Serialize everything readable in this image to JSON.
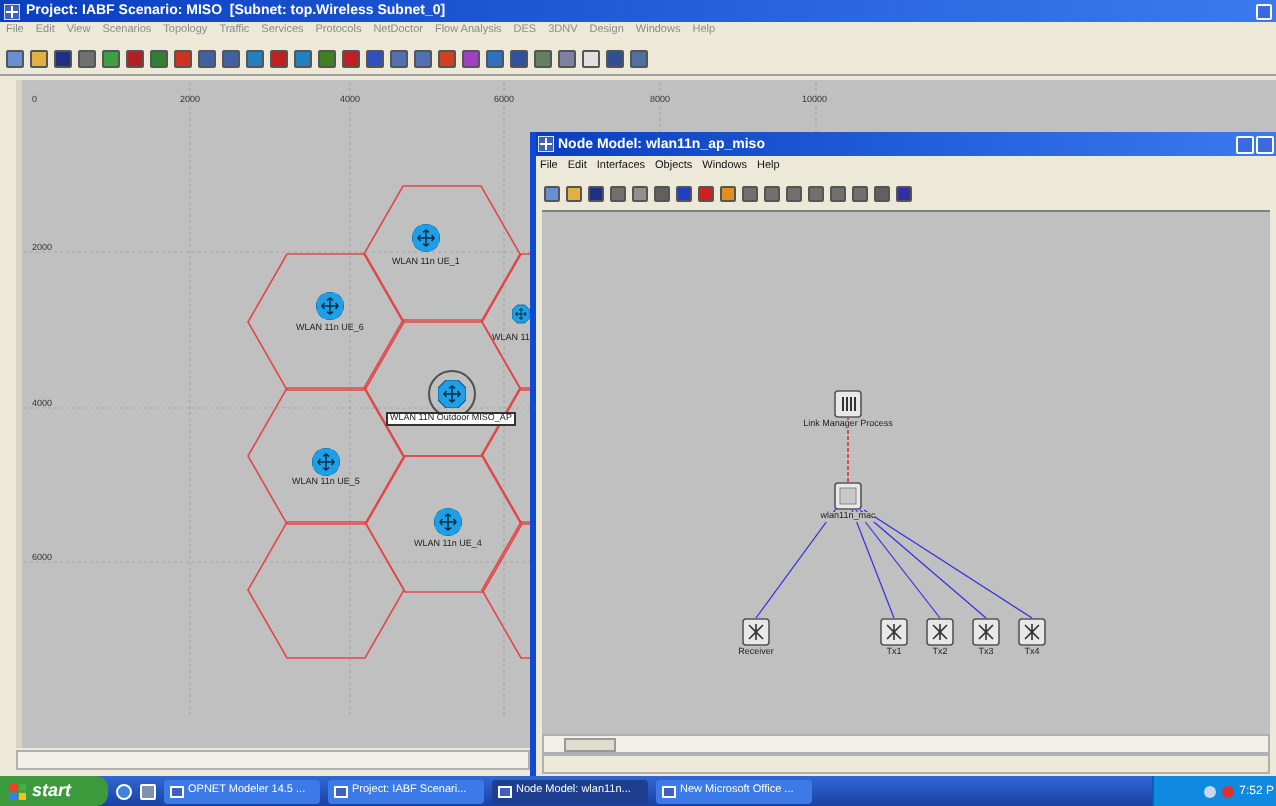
{
  "window": {
    "title": "Project: IABF Scenario: MISO  [Subnet: top.Wireless Subnet_0]"
  },
  "menu": [
    "File",
    "Edit",
    "View",
    "Scenarios",
    "Topology",
    "Traffic",
    "Services",
    "Protocols",
    "NetDoctor",
    "Flow Analysis",
    "DES",
    "3DNV",
    "Design",
    "Windows",
    "Help"
  ],
  "canvas": {
    "x_ticks": [
      "0",
      "2000",
      "4000",
      "6000",
      "8000",
      "10000"
    ],
    "y_ticks": [
      "2000",
      "4000",
      "6000"
    ],
    "nodes": [
      {
        "label": "WLAN 11n UE_1",
        "selected": false
      },
      {
        "label": "WLAN 11n UE_6",
        "selected": false
      },
      {
        "label": "WLAN 11",
        "selected": false
      },
      {
        "label": "WLAN 11N Outdoor MISO_AP",
        "selected": true
      },
      {
        "label": "WLAN 11n UE_5",
        "selected": false
      },
      {
        "label": "WLAN 11n UE_4",
        "selected": false
      }
    ]
  },
  "node_model": {
    "title": "Node Model: wlan11n_ap_miso",
    "menu": [
      "File",
      "Edit",
      "Interfaces",
      "Objects",
      "Windows",
      "Help"
    ],
    "modules": [
      {
        "label": "Link Manager Process",
        "kind": "processor"
      },
      {
        "label": "wlan11n_mac",
        "kind": "queue"
      },
      {
        "label": "Receiver",
        "kind": "radio"
      },
      {
        "label": "Tx1",
        "kind": "radio"
      },
      {
        "label": "Tx2",
        "kind": "radio"
      },
      {
        "label": "Tx3",
        "kind": "radio"
      },
      {
        "label": "Tx4",
        "kind": "radio"
      }
    ]
  },
  "taskbar": {
    "start": "start",
    "buttons": [
      {
        "label": "OPNET Modeler 14.5 ...",
        "selected": false
      },
      {
        "label": "Project: IABF Scenari...",
        "selected": false
      },
      {
        "label": "Node Model: wlan11n...",
        "selected": true
      },
      {
        "label": "New Microsoft Office ...",
        "selected": false
      }
    ],
    "clock": "7:52 P"
  }
}
